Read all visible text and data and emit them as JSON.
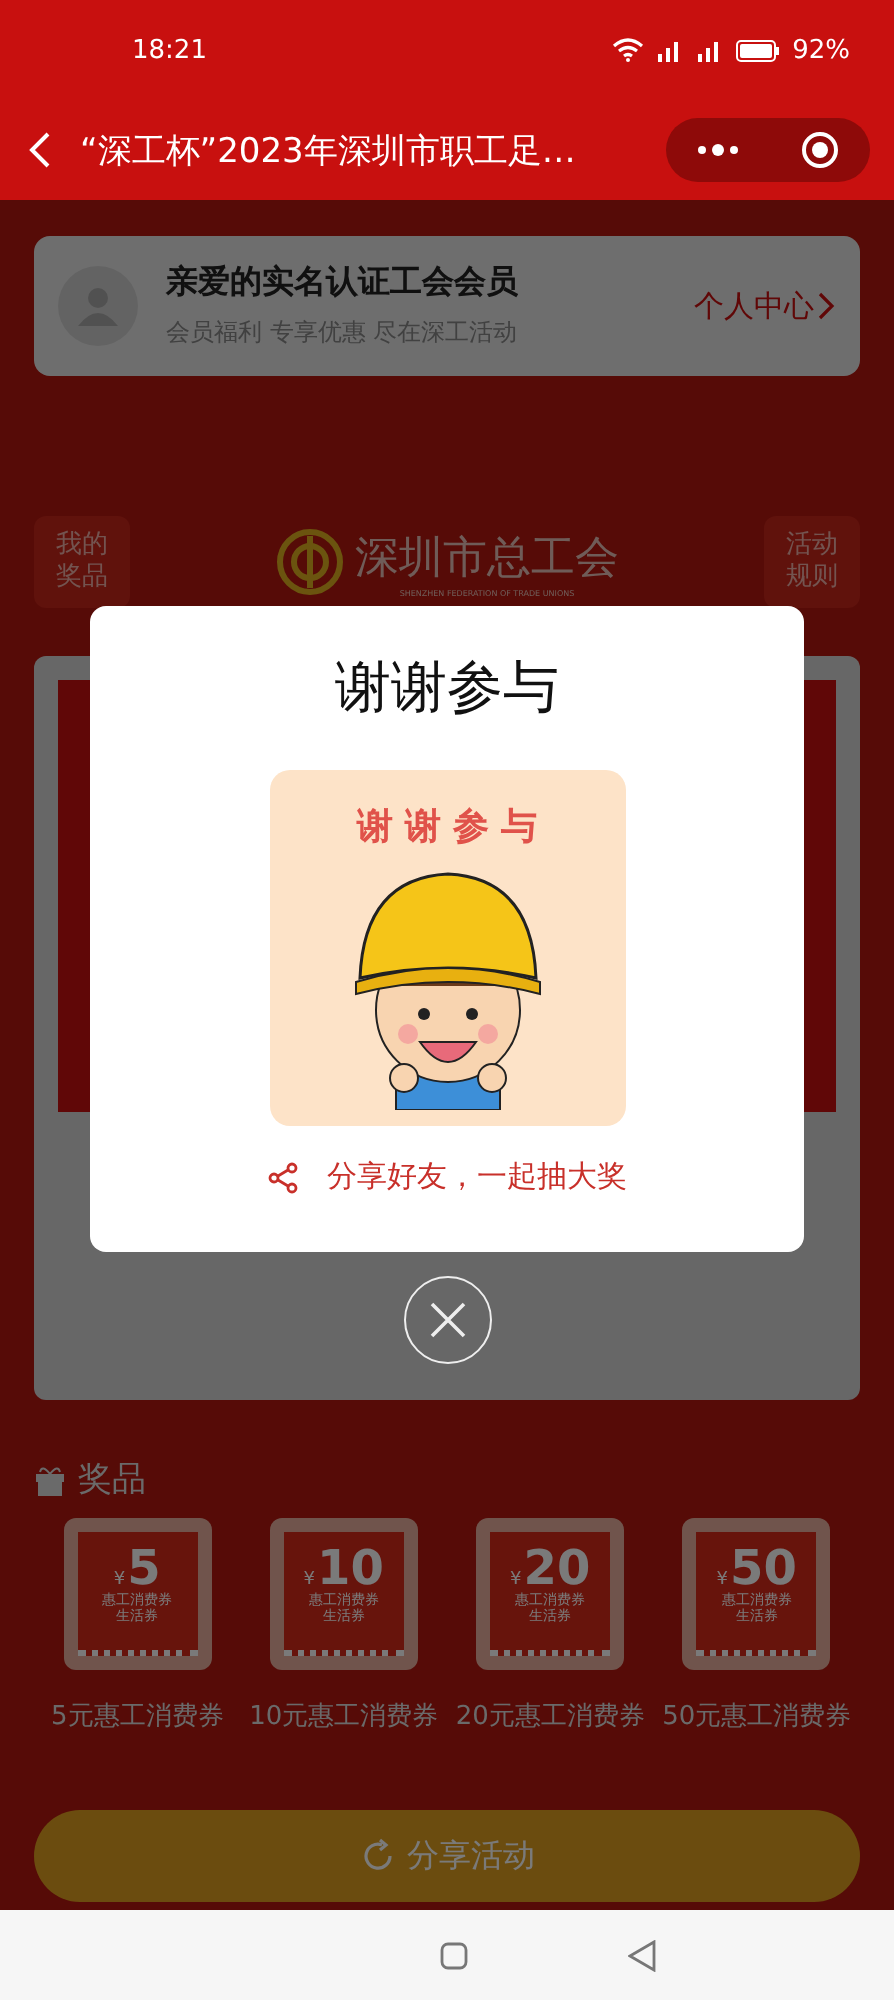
{
  "status_bar": {
    "time": "18:21",
    "battery": "92%"
  },
  "nav_bar": {
    "title": "“深工杯”2023年深圳市职工足…"
  },
  "member_card": {
    "title": "亲爱的实名认证工会会员",
    "subtitle": "会员福利 专享优惠 尽在深工活动",
    "link": "个人中心"
  },
  "side_buttons": [
    {
      "label": "我的奖品"
    },
    {
      "label": "活动规则"
    }
  ],
  "logo": {
    "name": "深圳市总工会",
    "subtitle": "SHENZHEN FEDERATION OF TRADE UNIONS"
  },
  "prizes": {
    "title": "奖品",
    "items": [
      {
        "currency": "¥",
        "amount": "5",
        "line1": "惠工消费券",
        "line2": "生活券",
        "label": "5元惠工消费券"
      },
      {
        "currency": "¥",
        "amount": "10",
        "line1": "惠工消费券",
        "line2": "生活券",
        "label": "10元惠工消费券"
      },
      {
        "currency": "¥",
        "amount": "20",
        "line1": "惠工消费券",
        "line2": "生活券",
        "label": "20元惠工消费券"
      },
      {
        "currency": "¥",
        "amount": "50",
        "line1": "惠工消费券",
        "line2": "生活券",
        "label": "50元惠工消费券"
      }
    ]
  },
  "share_button": "分享活动",
  "modal": {
    "title": "谢谢参与",
    "image_caption": "谢谢参与",
    "share_text": "分享好友，一起抽大奖"
  }
}
